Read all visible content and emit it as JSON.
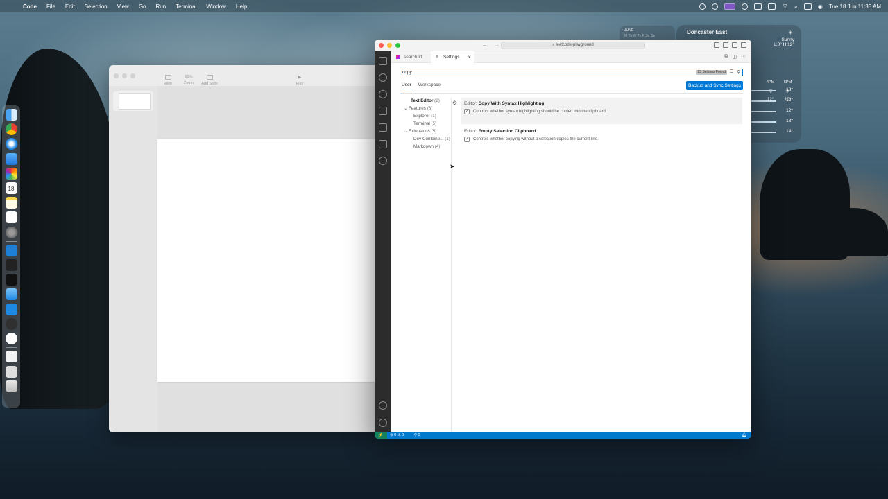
{
  "menubar": {
    "app_name": "Code",
    "items": [
      "File",
      "Edit",
      "Selection",
      "View",
      "Go",
      "Run",
      "Terminal",
      "Window",
      "Help"
    ],
    "clock": "Tue 18 Jun  11:35 AM"
  },
  "dock": {
    "calendar_day": "18",
    "apps": [
      "finder-icon",
      "chrome-icon",
      "safari-icon",
      "mail-icon",
      "photos-icon",
      "calendar-icon",
      "notes-icon",
      "reminders-icon",
      "settings-icon",
      "trello-icon",
      "terminal-editor-icon",
      "terminal-icon",
      "preview-icon",
      "vscode-icon",
      "obs-icon",
      "chatgpt-icon",
      "document-icon",
      "screenshot-icon",
      "trash-icon"
    ]
  },
  "keynote": {
    "zoom": "65%",
    "tools": [
      "View",
      "Zoom",
      "Add Slide",
      "Play"
    ]
  },
  "calendar_widget": {
    "month": "JUNE",
    "days": "M  Tu  W  Th  F  Sa  Su"
  },
  "weather": {
    "city": "Doncaster East",
    "condition": "Sunny",
    "range": "L:0° H:12°",
    "hours": [
      "4PM",
      "5PM"
    ],
    "hour_temps": [
      "12°",
      "10°"
    ],
    "forecast_temps": [
      "13°",
      "12°",
      "12°",
      "13°",
      "14°"
    ]
  },
  "vscode": {
    "command_center": "leetcode-playground",
    "tabs": [
      {
        "label": "search.kt",
        "active": false
      },
      {
        "label": "Settings",
        "active": true
      }
    ],
    "search_value": "copy",
    "search_count": "13 Settings Found",
    "scopes": [
      "User",
      "Workspace"
    ],
    "sync_button": "Backup and Sync Settings",
    "toc": [
      {
        "label": "Text Editor",
        "count": "(2)"
      },
      {
        "label": "Features",
        "count": "(6)"
      },
      {
        "label": "Explorer",
        "count": "(1)"
      },
      {
        "label": "Terminal",
        "count": "(5)"
      },
      {
        "label": "Extensions",
        "count": "(5)"
      },
      {
        "label": "Dev Containe...",
        "count": "(1)"
      },
      {
        "label": "Markdown",
        "count": "(4)"
      }
    ],
    "settings": [
      {
        "category": "Editor: ",
        "name": "Copy With Syntax Highlighting",
        "description": "Controls whether syntax highlighting should be copied into the clipboard.",
        "checked": true
      },
      {
        "category": "Editor: ",
        "name": "Empty Selection Clipboard",
        "description": "Controls whether copying without a selection copies the current line.",
        "checked": true
      }
    ],
    "status": {
      "problems": "⊗ 0 ⚠ 0",
      "ports": "⚲ 0"
    }
  },
  "colors": {
    "accent": "#0078d4",
    "statusbar": "#007acc",
    "activity_bar": "#2c2c2c"
  }
}
